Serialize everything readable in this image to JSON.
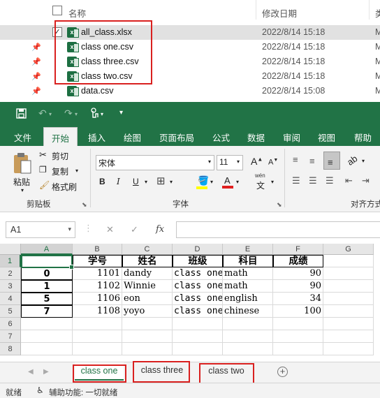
{
  "explorer": {
    "header": {
      "name": "名称",
      "modified": "修改日期",
      "type": "类"
    },
    "files": [
      {
        "name": "all_class.xlsx",
        "date": "2022/8/14 15:18",
        "type": "M",
        "checked": true,
        "selected": true,
        "pinned": false
      },
      {
        "name": "class one.csv",
        "date": "2022/8/14 15:18",
        "type": "M",
        "checked": false,
        "selected": false,
        "pinned": true
      },
      {
        "name": "class three.csv",
        "date": "2022/8/14 15:18",
        "type": "M",
        "checked": false,
        "selected": false,
        "pinned": true
      },
      {
        "name": "class two.csv",
        "date": "2022/8/14 15:18",
        "type": "M",
        "checked": false,
        "selected": false,
        "pinned": true
      },
      {
        "name": "data.csv",
        "date": "2022/8/14 15:08",
        "type": "M",
        "checked": false,
        "selected": false,
        "pinned": true
      }
    ],
    "icon": "excel-file-icon",
    "checkmark": "✓"
  },
  "excel": {
    "accent": "#217346",
    "annotation_color": "#d9201f",
    "qat": {
      "save_icon": "save-icon",
      "undo_icon": "undo-icon",
      "redo_icon": "redo-icon",
      "touch_icon": "touch-mode-icon",
      "customize_icon": "customize-qat-icon"
    },
    "tabs": [
      "文件",
      "开始",
      "插入",
      "绘图",
      "页面布局",
      "公式",
      "数据",
      "审阅",
      "视图",
      "帮助"
    ],
    "active_tab": "开始",
    "ribbon": {
      "clipboard": {
        "paste": "粘贴",
        "cut": "剪切",
        "copy": "复制",
        "format_painter": "格式刷",
        "group_label": "剪贴板"
      },
      "font": {
        "font_name": "宋体",
        "font_size": "11",
        "bold": "B",
        "italic": "I",
        "underline": "U",
        "wen": "wén",
        "wen_char": "文",
        "group_label": "字体"
      },
      "alignment": {
        "group_label": "对齐方式"
      }
    },
    "formula_bar": {
      "name_box": "A1",
      "fx": "fx",
      "formula": ""
    },
    "columns": [
      "A",
      "B",
      "C",
      "D",
      "E",
      "F",
      "G"
    ],
    "row_numbers": [
      "1",
      "2",
      "3",
      "4",
      "5",
      "6",
      "7",
      "8"
    ],
    "table_header": [
      "学号",
      "姓名",
      "班级",
      "科目",
      "成绩"
    ],
    "rows": [
      {
        "index": "0",
        "id": "1101",
        "name": "dandy",
        "class": "class one",
        "subject": "math",
        "score": "90"
      },
      {
        "index": "1",
        "id": "1102",
        "name": "Winnie",
        "class": "class one",
        "subject": "math",
        "score": "90"
      },
      {
        "index": "5",
        "id": "1106",
        "name": "eon",
        "class": "class one",
        "subject": "english",
        "score": "34"
      },
      {
        "index": "7",
        "id": "1108",
        "name": "yoyo",
        "class": "class one",
        "subject": "chinese",
        "score": "100"
      }
    ],
    "sheets": [
      "class one",
      "class three",
      "class two"
    ],
    "active_sheet": "class one",
    "add_sheet": "+",
    "status": {
      "ready": "就绪",
      "accessibility": "辅助功能: 一切就绪"
    }
  }
}
